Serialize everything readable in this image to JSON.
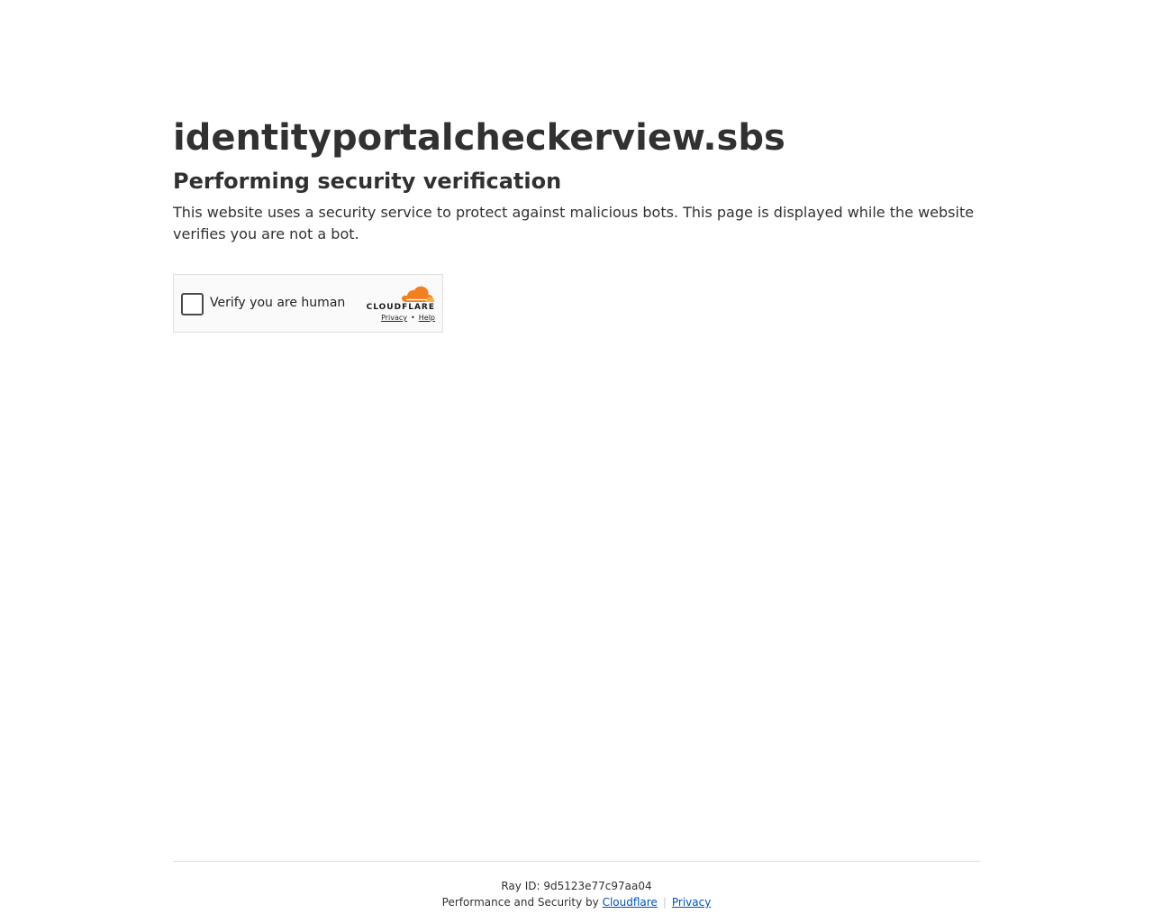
{
  "header": {
    "site_title": "identityportalcheckerview.sbs",
    "subtitle": "Performing security verification",
    "description": "This website uses a security service to protect against malicious bots. This page is displayed while the website verifies you are not a bot."
  },
  "widget": {
    "checkbox_label": "Verify you are human",
    "brand_name": "CLOUDFLARE",
    "privacy_link": "Privacy",
    "separator": "•",
    "help_link": "Help",
    "brand_colors": {
      "cloud_dark": "#f38020",
      "cloud_light": "#faae40"
    }
  },
  "footer": {
    "ray_label": "Ray ID:",
    "ray_value": "9d5123e77c97aa04",
    "performance_text": "Performance and Security by",
    "cloudflare_link": "Cloudflare",
    "divider": "|",
    "privacy_link": "Privacy",
    "link_color": "#0051c3"
  }
}
